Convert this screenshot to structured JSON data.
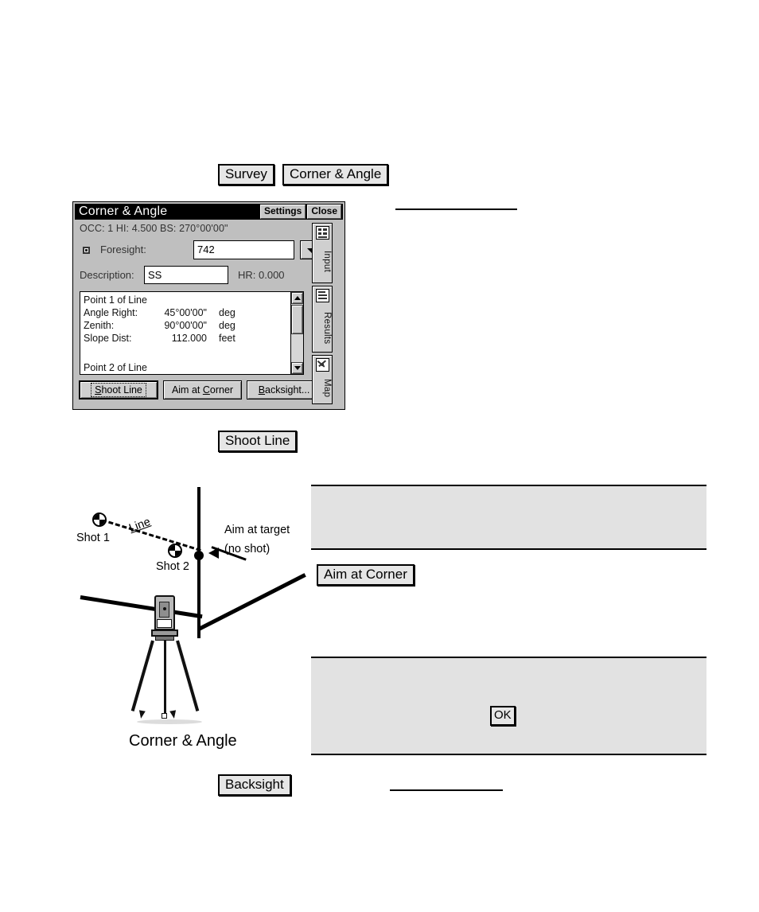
{
  "top_labels": {
    "survey": "Survey",
    "corner_angle": "Corner & Angle"
  },
  "dialog": {
    "title": "Corner & Angle",
    "settings_button": "Settings",
    "close_button": "Close",
    "status_line": "OCC: 1  HI: 4.500  BS: 270°00'00\"",
    "foresight": {
      "label": "Foresight:",
      "value": "742",
      "dropdown_icon": "chevron-down-icon",
      "bullet_icon": "radio-selected-icon"
    },
    "description": {
      "label": "Description:",
      "value": "SS"
    },
    "hr": "HR: 0.000",
    "list": {
      "heading": "Point 1 of Line",
      "rows": [
        {
          "key": "Angle Right:",
          "value": "45°00'00\"",
          "unit": "deg"
        },
        {
          "key": "Zenith:",
          "value": "90°00'00\"",
          "unit": "deg"
        },
        {
          "key": "Slope Dist:",
          "value": "112.000",
          "unit": "feet"
        }
      ],
      "next_heading": "Point 2 of Line",
      "scroll_up_icon": "triangle-up-icon",
      "scroll_down_icon": "triangle-down-icon"
    },
    "buttons": {
      "shoot_line": "Shoot Line",
      "aim_at_corner": "Aim at Corner",
      "backsight": "Backsight..."
    },
    "tabs": [
      {
        "label": "Input",
        "icon": "form-input-icon"
      },
      {
        "label": "Results",
        "icon": "document-results-icon"
      },
      {
        "label": "Map",
        "icon": "map-crosshair-icon"
      }
    ]
  },
  "shoot_line_label": "Shoot Line",
  "aim_at_corner_label": "Aim at  Corner",
  "backsight_label": "Backsight",
  "ok_label": "OK",
  "diagram": {
    "shot1": "Shot 1",
    "shot2": "Shot 2",
    "line": "Line",
    "aim_target_1": "Aim at target",
    "aim_target_2": "(no shot)",
    "caption": "Corner & Angle",
    "instrument_icon": "total-station-tripod-icon"
  }
}
